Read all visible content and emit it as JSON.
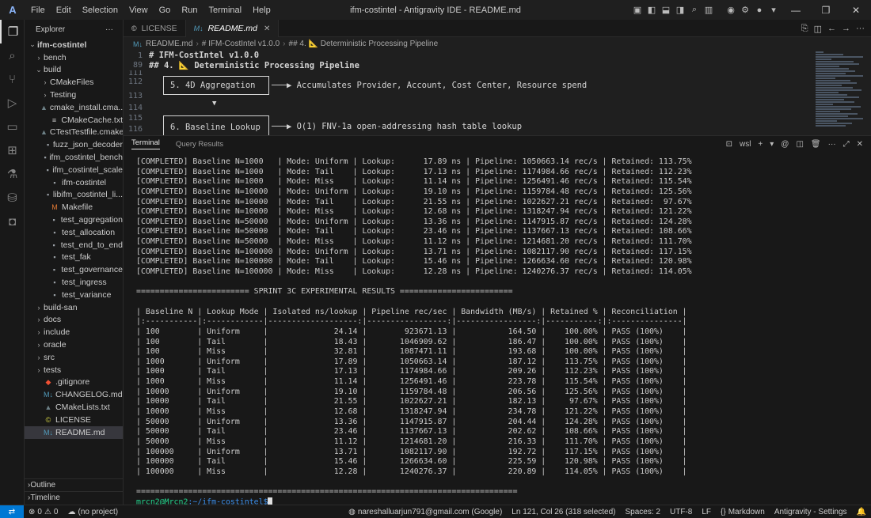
{
  "titlebar": {
    "logo": "A",
    "menu": [
      "File",
      "Edit",
      "Selection",
      "View",
      "Go",
      "Run",
      "Terminal",
      "Help"
    ],
    "title": "ifm-costintel - Antigravity IDE - README.md"
  },
  "explorer": {
    "header": "Explorer",
    "more": "···",
    "root": "ifm-costintel",
    "items": [
      {
        "label": "bench",
        "kind": "folder",
        "depth": 1,
        "open": false
      },
      {
        "label": "build",
        "kind": "folder",
        "depth": 1,
        "open": true
      },
      {
        "label": "CMakeFiles",
        "kind": "folder",
        "depth": 2,
        "open": false
      },
      {
        "label": "Testing",
        "kind": "folder",
        "depth": 2,
        "open": false
      },
      {
        "label": "cmake_install.cma...",
        "kind": "cmake",
        "depth": 2
      },
      {
        "label": "CMakeCache.txt",
        "kind": "text",
        "depth": 2
      },
      {
        "label": "CTestTestfile.cmake",
        "kind": "cmake",
        "depth": 2
      },
      {
        "label": "fuzz_json_decoder",
        "kind": "file",
        "depth": 2
      },
      {
        "label": "ifm_costintel_bench",
        "kind": "file",
        "depth": 2
      },
      {
        "label": "ifm_costintel_scale",
        "kind": "file",
        "depth": 2
      },
      {
        "label": "ifm-costintel",
        "kind": "file",
        "depth": 2
      },
      {
        "label": "libifm_costintel_li...",
        "kind": "file",
        "depth": 2
      },
      {
        "label": "Makefile",
        "kind": "make",
        "depth": 2
      },
      {
        "label": "test_aggregation",
        "kind": "file",
        "depth": 2
      },
      {
        "label": "test_allocation",
        "kind": "file",
        "depth": 2
      },
      {
        "label": "test_end_to_end",
        "kind": "file",
        "depth": 2
      },
      {
        "label": "test_fak",
        "kind": "file",
        "depth": 2
      },
      {
        "label": "test_governance",
        "kind": "file",
        "depth": 2
      },
      {
        "label": "test_ingress",
        "kind": "file",
        "depth": 2
      },
      {
        "label": "test_variance",
        "kind": "file",
        "depth": 2
      },
      {
        "label": "build-san",
        "kind": "folder",
        "depth": 1,
        "open": false
      },
      {
        "label": "docs",
        "kind": "folder",
        "depth": 1,
        "open": false
      },
      {
        "label": "include",
        "kind": "folder",
        "depth": 1,
        "open": false
      },
      {
        "label": "oracle",
        "kind": "folder",
        "depth": 1,
        "open": false
      },
      {
        "label": "src",
        "kind": "folder",
        "depth": 1,
        "open": false
      },
      {
        "label": "tests",
        "kind": "folder",
        "depth": 1,
        "open": false
      },
      {
        "label": ".gitignore",
        "kind": "git",
        "depth": 1
      },
      {
        "label": "CHANGELOG.md",
        "kind": "md",
        "depth": 1
      },
      {
        "label": "CMakeLists.txt",
        "kind": "cmake",
        "depth": 1
      },
      {
        "label": "LICENSE",
        "kind": "license",
        "depth": 1
      },
      {
        "label": "README.md",
        "kind": "md",
        "depth": 1,
        "selected": true
      }
    ],
    "outline": "Outline",
    "timeline": "Timeline"
  },
  "editor": {
    "tabs": [
      {
        "label": "LICENSE",
        "active": false,
        "icon": "license-icon"
      },
      {
        "label": "README.md",
        "active": true,
        "icon": "markdown-icon"
      }
    ],
    "breadcrumb": [
      "README.md",
      "# IFM-CostIntel v1.0.0",
      "## 4. 📐 Deterministic Processing Pipeline"
    ],
    "sticky": [
      {
        "ln": "1",
        "text": "# IFM-CostIntel v1.0.0"
      },
      {
        "ln": "89",
        "text": "## 4. 📐 Deterministic Processing Pipeline"
      }
    ],
    "lines": [
      "111",
      "112",
      "113",
      "114",
      "115",
      "116"
    ],
    "box1": "5. 4D Aggregation",
    "box1_arrow": "───▶ Accumulates Provider, Account, Cost Center, Resource spend",
    "box2": "6. Baseline Lookup",
    "box2_arrow": "───▶ O(1) FNV-1a open-addressing hash table lookup",
    "down_arrow": "▼"
  },
  "panel": {
    "tabs": [
      "Terminal",
      "Query Results"
    ],
    "shell": "wsl"
  },
  "terminal": {
    "completed": [
      "[COMPLETED] Baseline N=1000   | Mode: Uniform | Lookup:      17.89 ns | Pipeline: 1050663.14 rec/s | Retained: 113.75%",
      "[COMPLETED] Baseline N=1000   | Mode: Tail    | Lookup:      17.13 ns | Pipeline: 1174984.66 rec/s | Retained: 112.23%",
      "[COMPLETED] Baseline N=1000   | Mode: Miss    | Lookup:      11.14 ns | Pipeline: 1256491.46 rec/s | Retained: 115.54%",
      "[COMPLETED] Baseline N=10000  | Mode: Uniform | Lookup:      19.10 ns | Pipeline: 1159784.48 rec/s | Retained: 125.56%",
      "[COMPLETED] Baseline N=10000  | Mode: Tail    | Lookup:      21.55 ns | Pipeline: 1022627.21 rec/s | Retained:  97.67%",
      "[COMPLETED] Baseline N=10000  | Mode: Miss    | Lookup:      12.68 ns | Pipeline: 1318247.94 rec/s | Retained: 121.22%",
      "[COMPLETED] Baseline N=50000  | Mode: Uniform | Lookup:      13.36 ns | Pipeline: 1147915.87 rec/s | Retained: 124.28%",
      "[COMPLETED] Baseline N=50000  | Mode: Tail    | Lookup:      23.46 ns | Pipeline: 1137667.13 rec/s | Retained: 108.66%",
      "[COMPLETED] Baseline N=50000  | Mode: Miss    | Lookup:      11.12 ns | Pipeline: 1214681.20 rec/s | Retained: 111.70%",
      "[COMPLETED] Baseline N=100000 | Mode: Uniform | Lookup:      13.71 ns | Pipeline: 1082117.90 rec/s | Retained: 117.15%",
      "[COMPLETED] Baseline N=100000 | Mode: Tail    | Lookup:      15.46 ns | Pipeline: 1266634.60 rec/s | Retained: 120.98%",
      "[COMPLETED] Baseline N=100000 | Mode: Miss    | Lookup:      12.28 ns | Pipeline: 1240276.37 rec/s | Retained: 114.05%"
    ],
    "banner": "======================== SPRINT 3C EXPERIMENTAL RESULTS ========================",
    "table_header": "| Baseline N | Lookup Mode | Isolated ns/lookup | Pipeline rec/sec | Bandwidth (MB/s) | Retained % | Reconciliation |",
    "table_sep": "|:-----------|:------------|-------------------:|-----------------:|-----------------:|-----------:|:---------------|",
    "table_rows": [
      "| 100        | Uniform     |              24.14 |        923671.13 |           164.50 |    100.00% | PASS (100%)    |",
      "| 100        | Tail        |              18.43 |       1046909.62 |           186.47 |    100.00% | PASS (100%)    |",
      "| 100        | Miss        |              32.81 |       1087471.11 |           193.68 |    100.00% | PASS (100%)    |",
      "| 1000       | Uniform     |              17.89 |       1050663.14 |           187.12 |    113.75% | PASS (100%)    |",
      "| 1000       | Tail        |              17.13 |       1174984.66 |           209.26 |    112.23% | PASS (100%)    |",
      "| 1000       | Miss        |              11.14 |       1256491.46 |           223.78 |    115.54% | PASS (100%)    |",
      "| 10000      | Uniform     |              19.10 |       1159784.48 |           206.56 |    125.56% | PASS (100%)    |",
      "| 10000      | Tail        |              21.55 |       1022627.21 |           182.13 |     97.67% | PASS (100%)    |",
      "| 10000      | Miss        |              12.68 |       1318247.94 |           234.78 |    121.22% | PASS (100%)    |",
      "| 50000      | Uniform     |              13.36 |       1147915.87 |           204.44 |    124.28% | PASS (100%)    |",
      "| 50000      | Tail        |              23.46 |       1137667.13 |           202.62 |    108.66% | PASS (100%)    |",
      "| 50000      | Miss        |              11.12 |       1214681.20 |           216.33 |    111.70% | PASS (100%)    |",
      "| 100000     | Uniform     |              13.71 |       1082117.90 |           192.72 |    117.15% | PASS (100%)    |",
      "| 100000     | Tail        |              15.46 |       1266634.60 |           225.59 |    120.98% | PASS (100%)    |",
      "| 100000     | Miss        |              12.28 |       1240276.37 |           220.89 |    114.05% | PASS (100%)    |"
    ],
    "footer_rule": "=================================================================================",
    "prompt_user": "mrcn2@Mrcn2",
    "prompt_path": ":~/ifm-costintel$"
  },
  "statusbar": {
    "errors": "0",
    "warnings": "0",
    "project": "(no project)",
    "account": "nareshalluarjun791@gmail.com (Google)",
    "position": "Ln 121, Col 26 (318 selected)",
    "spaces": "Spaces: 2",
    "encoding": "UTF-8",
    "eol": "LF",
    "language": "Markdown",
    "settings": "Antigravity - Settings"
  },
  "colors": {
    "accent": "#0078d4",
    "heading": "#569cd6",
    "prompt_user": "#23d18b",
    "prompt_path": "#3b8eea"
  }
}
